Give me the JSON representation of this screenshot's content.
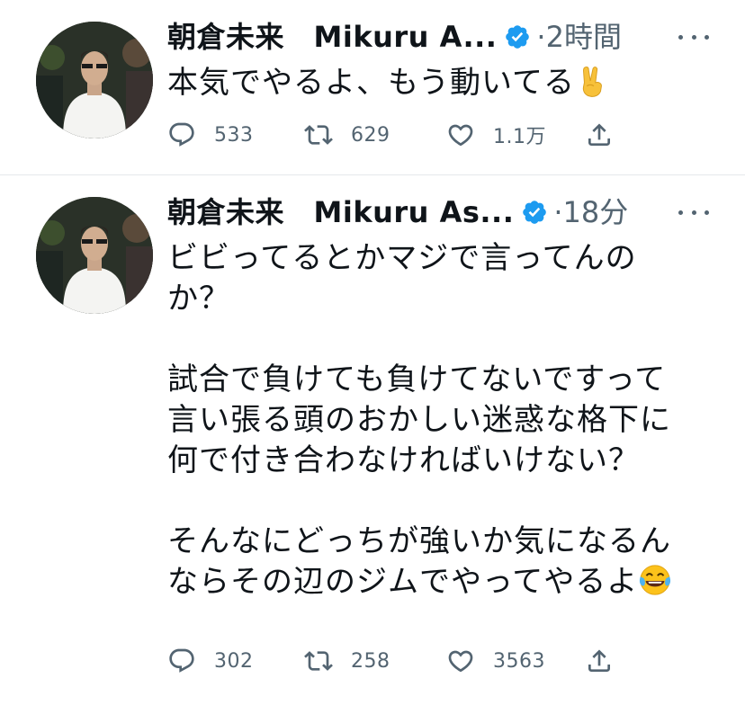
{
  "tweets": [
    {
      "display_name": "朝倉未来　Mikuru A...",
      "separator": "·",
      "time": "2時間",
      "text": "本気でやるよ、もう動いてる",
      "trailing_emoji": "victory-hand",
      "stats": {
        "replies": "533",
        "retweets": "629",
        "likes": "1.1万"
      }
    },
    {
      "display_name": "朝倉未来　Mikuru As...",
      "separator": "·",
      "time": "18分",
      "text": "ビビってるとかマジで言ってんの\nか？\n\n試合で負けても負けてないですって\n言い張る頭のおかしい迷惑な格下に\n何で付き合わなければいけない？\n\nそんなにどっちが強いか気になるん\nならその辺のジムでやってやるよ",
      "trailing_emoji": "face-with-tears-of-joy",
      "stats": {
        "replies": "302",
        "retweets": "258",
        "likes": "3563"
      }
    }
  ],
  "colors": {
    "verified": "#1d9bf0",
    "muted": "#536471",
    "divider": "#e5e8eb"
  }
}
